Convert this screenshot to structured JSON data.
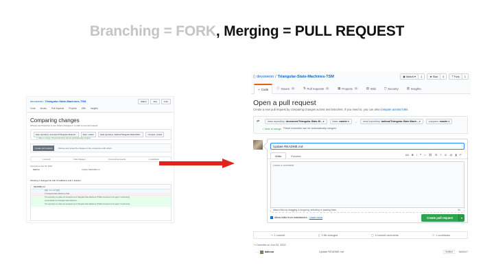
{
  "slide": {
    "title_part1": "Branching = FORK",
    "title_part2": ", Merging = PULL REQUEST"
  },
  "left_shot": {
    "repo_owner": "devowenn",
    "repo_name": "Triangular-State-Machines-TSM",
    "header_buttons": [
      "Watch",
      "Star",
      "Fork"
    ],
    "tabs": [
      "Code",
      "Issues",
      "Pull requests",
      "Projects",
      "Wiki",
      "Insights"
    ],
    "title": "Comparing changes",
    "subtitle": "Choose two branches to see what's changed or to start a new pull request.",
    "range": [
      "base repository: devowenn/Triangular-State-M...",
      "base: master",
      "head repository: balicoa/Triangular-State-Mach...",
      "compare: master"
    ],
    "range_ok": "✓ Able to merge. These branches can be automatically merged.",
    "create_button": "Create pull request",
    "create_text": "Discuss and review the changes in this comparison with others.",
    "stats": [
      "1 commit",
      "1 file changed",
      "0 commit comments",
      "1 contributor"
    ],
    "commits_on": "Commits on Jun 03, 2019",
    "commit_author": "balicoa",
    "commit_msg": "Update README.md",
    "showing": "Showing 1 changed file with 15 additions and 1 deletion.",
    "file_name": "README.md",
    "diff_lines": [
      "@@ -1,3 +1,17 @@",
      "# Triangular-State-Machines-TSM",
      "This repository is a place for development of Triangular State Machines (TSMs) introduced in the paper \"Constructing",
      "Accountability via Triangular State Machines ...",
      "This repository is a place for development of Triangular State Machines (TSMs) introduced in the paper \"Constructing"
    ]
  },
  "shot": {
    "repo_owner": "devowenn",
    "repo_sep": "/",
    "repo_name": "Triangular-State-Machines-TSM",
    "watch_label": "Watch",
    "watch_count": "1",
    "star_label": "Star",
    "star_count": "0",
    "fork_label": "Fork",
    "fork_count": "1",
    "nav": [
      {
        "label": "Code",
        "count": ""
      },
      {
        "label": "Issues",
        "count": "0"
      },
      {
        "label": "Pull requests",
        "count": "0"
      },
      {
        "label": "Projects",
        "count": "0"
      },
      {
        "label": "Wiki",
        "count": ""
      },
      {
        "label": "Security",
        "count": ""
      },
      {
        "label": "Insights",
        "count": ""
      }
    ],
    "title": "Open a pull request",
    "subtitle_text": "Create a new pull request by comparing changes across two branches. If you need to, you can also",
    "subtitle_link": "compare across forks.",
    "base_repo_label": "base repository:",
    "base_repo_value": "devowenn/Triangular-State-M...",
    "base_label": "base:",
    "base_value": "master",
    "head_repo_label": "head repository:",
    "head_repo_value": "balicoa/Triangular-State-Mach...",
    "compare_label": "compare:",
    "compare_value": "master",
    "able_to_merge": "✓ Able to merge.",
    "able_to_merge_rest": "These branches can be automatically merged.",
    "pr_title_value": "Update README.md",
    "write_tab": "Write",
    "preview_tab": "Preview",
    "comment_placeholder": "Leave a comment",
    "attach_text": "Attach files by dragging & dropping, selecting or pasting them.",
    "allow_edits": "Allow edits from maintainers.",
    "learn_more": "Learn more",
    "create_button": "Create pull request",
    "stat_commits": "1 commit",
    "stat_files": "1 file changed",
    "stat_comments": "0 commit comments",
    "stat_contributors": "1 contributor",
    "commits_on": "Commits on Jun 03, 2019",
    "commit_author": "balicoa",
    "commit_message": "Update README.md",
    "commit_verified": "Verified",
    "commit_sha": "5b5b917"
  },
  "colors": {
    "accent_link": "#0366d6",
    "green_button": "#2ea44f",
    "arrow_red": "#e0241b",
    "title_muted": "#c4c4c4"
  }
}
